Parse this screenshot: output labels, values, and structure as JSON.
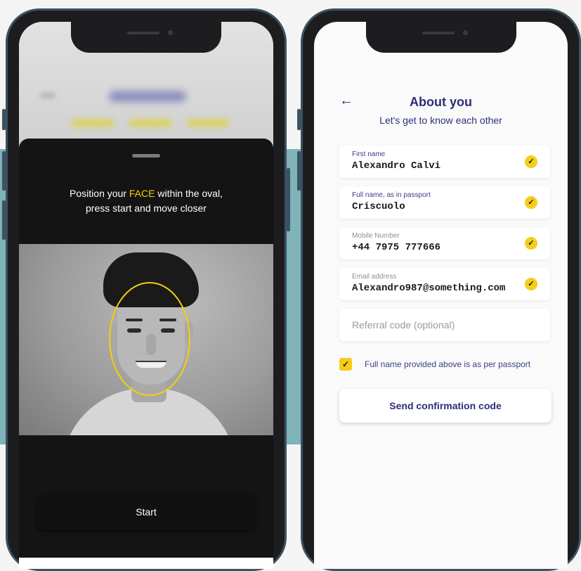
{
  "face_scan": {
    "instruction_before": "Position your ",
    "instruction_highlight": "FACE",
    "instruction_after": " within the oval,",
    "instruction_line2": "press start and move closer",
    "start_label": "Start"
  },
  "about": {
    "title": "About you",
    "subtitle": "Let's get to know each other",
    "fields": [
      {
        "label": "First name",
        "value": "Alexandro Calvi",
        "valid": true
      },
      {
        "label": "Full name, as in passport",
        "value": "Criscuolo",
        "valid": true
      },
      {
        "label": "Mobile Number",
        "value": "+44 7975 777666",
        "valid": true
      },
      {
        "label": "Email address",
        "value": "Alexandro987@something.com",
        "valid": true
      }
    ],
    "referral_placeholder": "Referral code (optional)",
    "checkbox_label": "Full name provided above is as per passport",
    "checkbox_checked": true,
    "send_label": "Send confirmation code"
  },
  "colors": {
    "accent_yellow": "#f5cd1a",
    "brand_navy": "#2b2e7a",
    "teal_band": "#7fb3b8"
  },
  "icons": {
    "back": "arrow-left-icon",
    "valid": "checkmark-circle-icon",
    "checkbox": "checkmark-icon"
  }
}
